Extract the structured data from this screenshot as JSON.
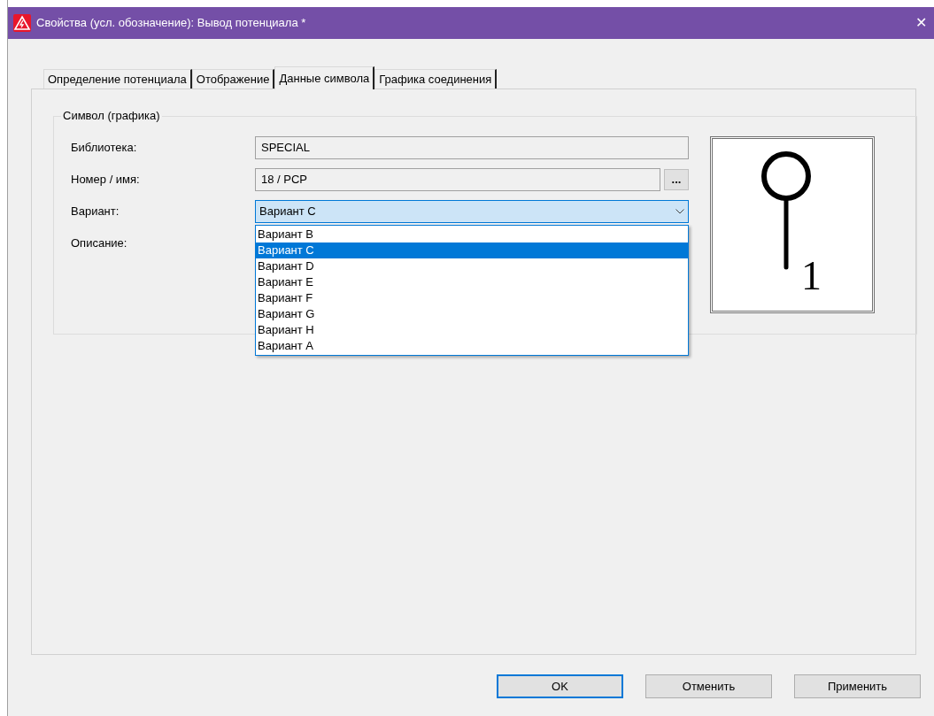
{
  "window": {
    "title": "Свойства (усл. обозначение): Вывод потенциала *",
    "close": "✕"
  },
  "tabs": [
    {
      "label": "Определение потенциала",
      "selected": false
    },
    {
      "label": "Отображение",
      "selected": false
    },
    {
      "label": "Данные символа",
      "selected": true
    },
    {
      "label": "Графика соединения",
      "selected": false
    }
  ],
  "group": {
    "title": "Символ (графика)",
    "fields": [
      {
        "kind": "text",
        "label": "Библиотека:",
        "value": "SPECIAL"
      },
      {
        "kind": "browse",
        "label": "Номер / имя:",
        "value": "18 / PCP",
        "button": "..."
      },
      {
        "kind": "combo",
        "label": "Вариант:",
        "value": "Вариант C",
        "expanded": true,
        "options": [
          {
            "label": "Вариант B",
            "selected": false
          },
          {
            "label": "Вариант C",
            "selected": true
          },
          {
            "label": "Вариант D",
            "selected": false
          },
          {
            "label": "Вариант E",
            "selected": false
          },
          {
            "label": "Вариант F",
            "selected": false
          },
          {
            "label": "Вариант G",
            "selected": false
          },
          {
            "label": "Вариант H",
            "selected": false
          },
          {
            "label": "Вариант A",
            "selected": false
          }
        ]
      },
      {
        "kind": "label",
        "label": "Описание:"
      }
    ],
    "preview": {
      "pin_label": "1"
    }
  },
  "buttons": [
    {
      "label": "OK",
      "default": true
    },
    {
      "label": "Отменить",
      "default": false
    },
    {
      "label": "Применить",
      "default": false
    }
  ]
}
